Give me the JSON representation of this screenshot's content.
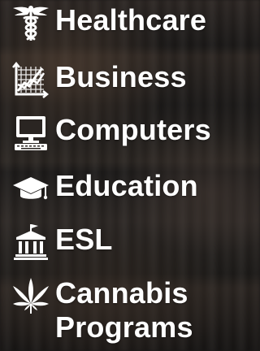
{
  "menu": {
    "items": [
      {
        "label": "Healthcare",
        "icon": "caduceus-icon"
      },
      {
        "label": "Business",
        "icon": "chart-icon"
      },
      {
        "label": "Computers",
        "icon": "computer-icon"
      },
      {
        "label": "Education",
        "icon": "graduation-cap-icon"
      },
      {
        "label": "ESL",
        "icon": "institution-icon"
      },
      {
        "label": "Cannabis\nPrograms",
        "icon": "cannabis-leaf-icon"
      }
    ]
  },
  "colors": {
    "text": "#ffffff",
    "icon": "#ffffff"
  }
}
